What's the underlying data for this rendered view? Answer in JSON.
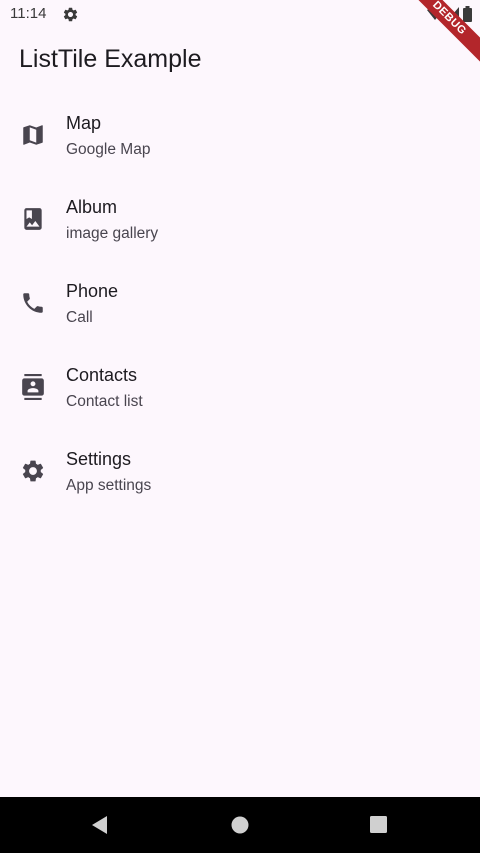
{
  "status_bar": {
    "time": "11:14",
    "debug_label": "DEBUG"
  },
  "app_bar": {
    "title": "ListTile Example"
  },
  "items": [
    {
      "title": "Map",
      "subtitle": "Google Map",
      "icon": "map-icon"
    },
    {
      "title": "Album",
      "subtitle": "image gallery",
      "icon": "photo-album-icon"
    },
    {
      "title": "Phone",
      "subtitle": "Call",
      "icon": "phone-icon"
    },
    {
      "title": "Contacts",
      "subtitle": "Contact list",
      "icon": "contacts-icon"
    },
    {
      "title": "Settings",
      "subtitle": "App settings",
      "icon": "settings-icon"
    }
  ],
  "colors": {
    "background": "#fdf7fd",
    "icon": "#49454f",
    "debug_banner": "#b3262b"
  }
}
